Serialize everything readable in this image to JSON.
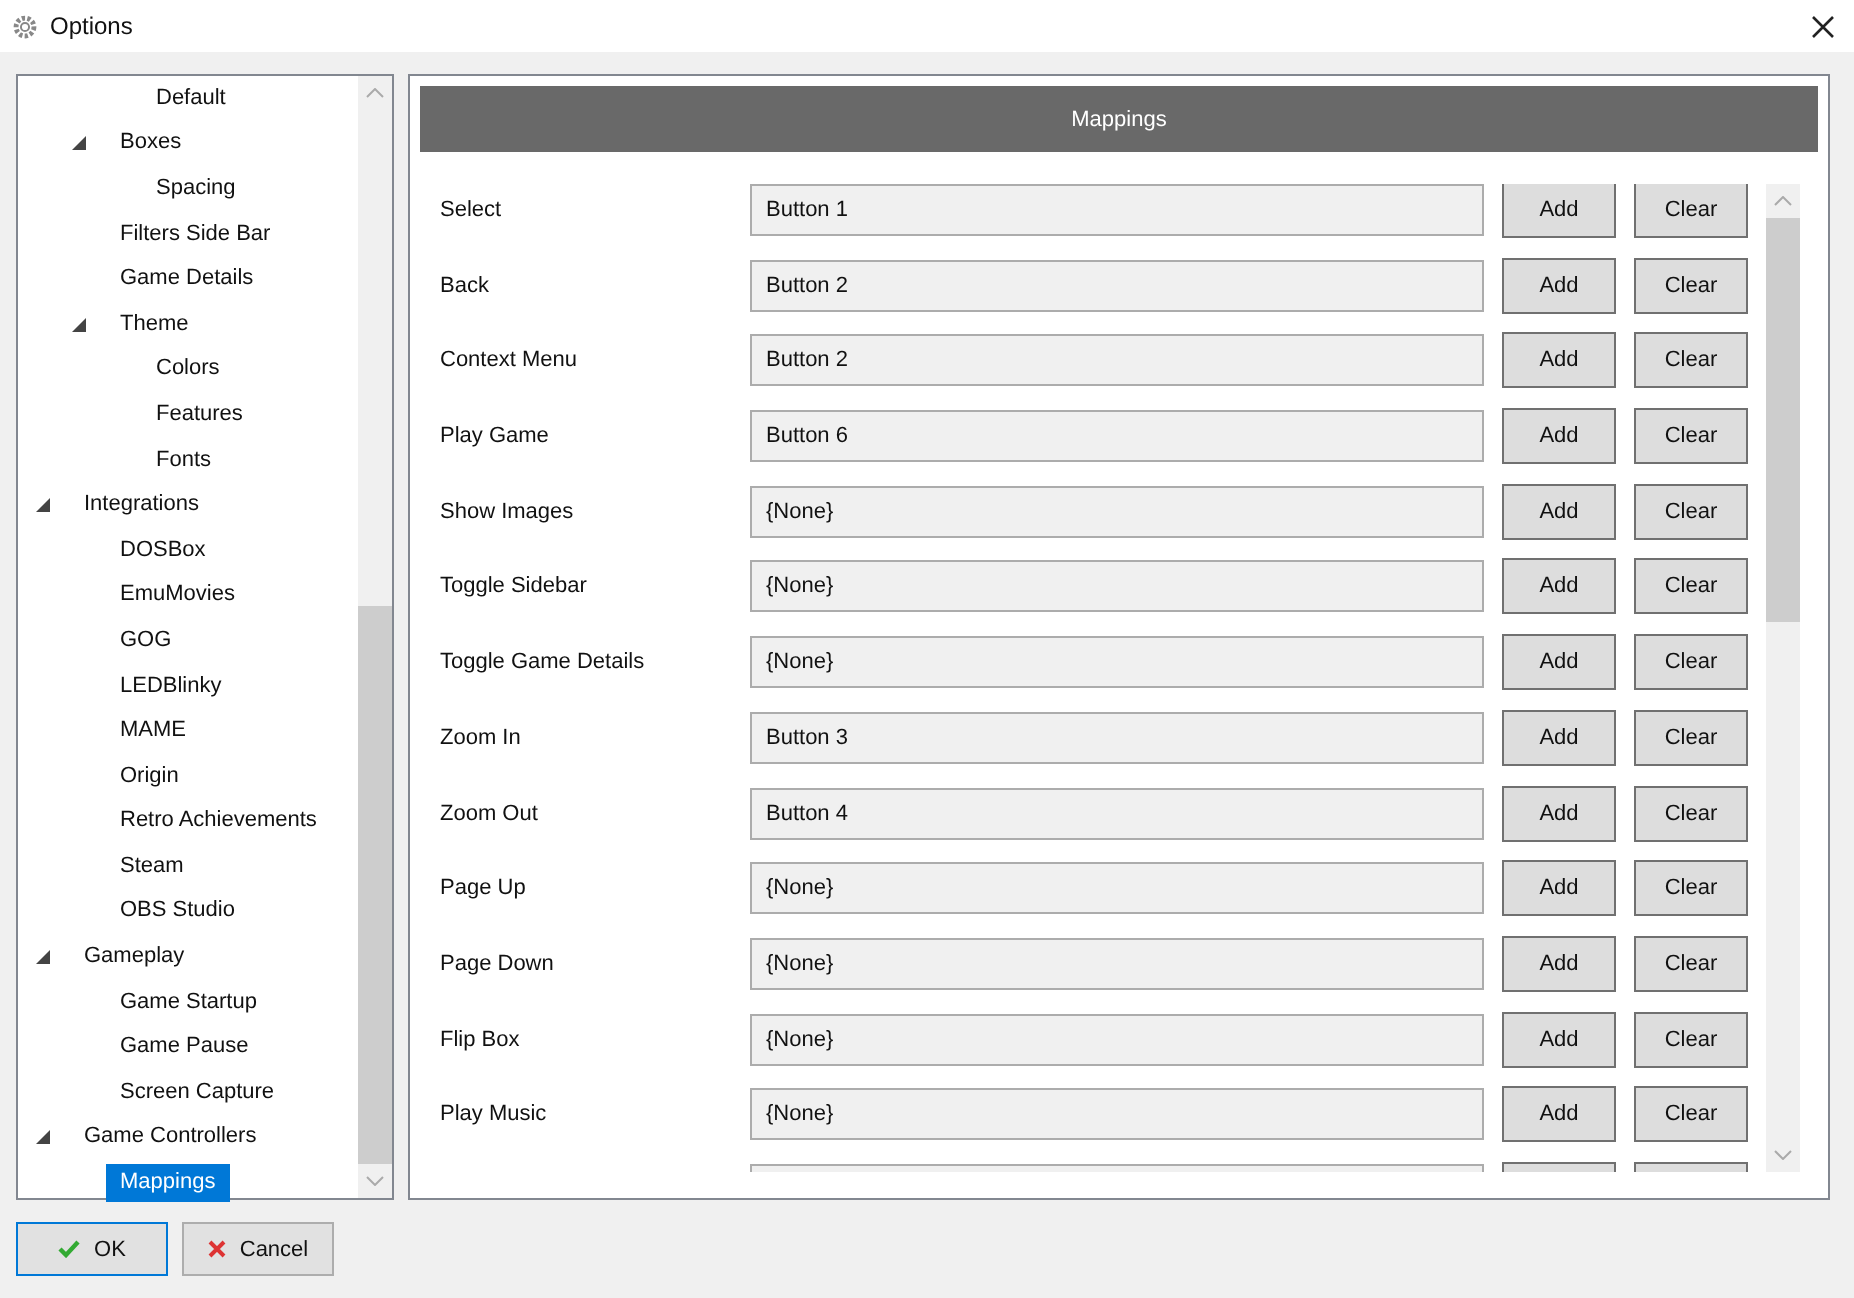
{
  "window": {
    "title": "Options"
  },
  "tree": [
    {
      "children": [
        {
          "children": [
            {
              "label": "Default",
              "selected": false
            }
          ]
        },
        {
          "label": "Boxes",
          "expanded": true,
          "selected": false,
          "children": [
            {
              "label": "Spacing",
              "selected": false
            }
          ]
        },
        {
          "label": "Filters Side Bar",
          "selected": false
        },
        {
          "label": "Game Details",
          "selected": false
        },
        {
          "label": "Theme",
          "expanded": true,
          "selected": false,
          "children": [
            {
              "label": "Colors",
              "selected": false
            },
            {
              "label": "Features",
              "selected": false
            },
            {
              "label": "Fonts",
              "selected": false
            }
          ]
        }
      ]
    },
    {
      "label": "Integrations",
      "expanded": true,
      "selected": false,
      "children": [
        {
          "label": "DOSBox",
          "selected": false
        },
        {
          "label": "EmuMovies",
          "selected": false
        },
        {
          "label": "GOG",
          "selected": false
        },
        {
          "label": "LEDBlinky",
          "selected": false
        },
        {
          "label": "MAME",
          "selected": false
        },
        {
          "label": "Origin",
          "selected": false
        },
        {
          "label": "Retro Achievements",
          "selected": false
        },
        {
          "label": "Steam",
          "selected": false
        },
        {
          "label": "OBS Studio",
          "selected": false
        }
      ]
    },
    {
      "label": "Gameplay",
      "expanded": true,
      "selected": false,
      "children": [
        {
          "label": "Game Startup",
          "selected": false
        },
        {
          "label": "Game Pause",
          "selected": false
        },
        {
          "label": "Screen Capture",
          "selected": false
        }
      ]
    },
    {
      "label": "Game Controllers",
      "expanded": true,
      "selected": false,
      "children": [
        {
          "label": "Mappings",
          "selected": true
        }
      ]
    }
  ],
  "panel": {
    "title": "Mappings",
    "rows": [
      {
        "label": "Select",
        "value": "Button 1",
        "add": "Add",
        "clear": "Clear"
      },
      {
        "label": "Back",
        "value": "Button 2",
        "add": "Add",
        "clear": "Clear"
      },
      {
        "label": "Context Menu",
        "value": "Button 2",
        "add": "Add",
        "clear": "Clear"
      },
      {
        "label": "Play Game",
        "value": "Button 6",
        "add": "Add",
        "clear": "Clear"
      },
      {
        "label": "Show Images",
        "value": "{None}",
        "add": "Add",
        "clear": "Clear"
      },
      {
        "label": "Toggle Sidebar",
        "value": "{None}",
        "add": "Add",
        "clear": "Clear"
      },
      {
        "label": "Toggle Game Details",
        "value": "{None}",
        "add": "Add",
        "clear": "Clear"
      },
      {
        "label": "Zoom In",
        "value": "Button 3",
        "add": "Add",
        "clear": "Clear"
      },
      {
        "label": "Zoom Out",
        "value": "Button 4",
        "add": "Add",
        "clear": "Clear"
      },
      {
        "label": "Page Up",
        "value": "{None}",
        "add": "Add",
        "clear": "Clear"
      },
      {
        "label": "Page Down",
        "value": "{None}",
        "add": "Add",
        "clear": "Clear"
      },
      {
        "label": "Flip Box",
        "value": "{None}",
        "add": "Add",
        "clear": "Clear"
      },
      {
        "label": "Play Music",
        "value": "{None}",
        "add": "Add",
        "clear": "Clear"
      }
    ],
    "partial_row": true
  },
  "buttons": [
    {
      "label": "OK",
      "kind": "ok"
    },
    {
      "label": "Cancel",
      "kind": "cancel"
    }
  ]
}
